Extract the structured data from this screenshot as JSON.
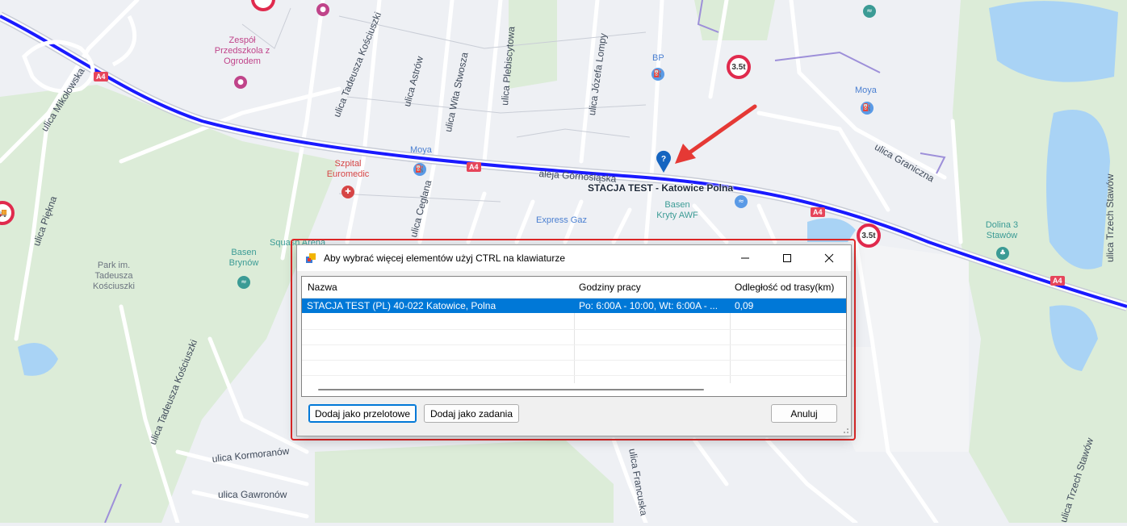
{
  "dialog": {
    "title": "Aby wybrać więcej elementów użyj CTRL na klawiaturze",
    "columns": [
      "Nazwa",
      "Godziny pracy",
      "Odległość od trasy(km)"
    ],
    "rows": [
      {
        "name": "STACJA TEST (PL) 40-022 Katowice, Polna",
        "hours": "Po: 6:00A - 10:00, Wt: 6:00A - ...",
        "distance": "0,09"
      }
    ],
    "buttons": {
      "add_waypoints": "Dodaj jako przelotowe",
      "add_tasks": "Dodaj jako zadania",
      "cancel": "Anuluj"
    },
    "window_icons": [
      "minimize-icon",
      "maximize-icon",
      "close-icon"
    ]
  },
  "map": {
    "station_label": "STACJA TEST - Katowice Polna",
    "streets": [
      "ulica Mikołowska",
      "ulica Tadeusza Kościuszki",
      "ulica Astrów",
      "ulica Wita Stwosza",
      "ulica Plebiscytowa",
      "ulica Józefa Lompy",
      "aleja Górnośląska",
      "ulica Graniczna",
      "ulica Trzech Stawów",
      "ulica Piękna",
      "ulica Ceglana",
      "ulica Tadeusza Kościuszki",
      "ulica Kormoranów",
      "ulica Gawronów",
      "ulica Francuska",
      "ulica Trzech Stawów"
    ],
    "pois": [
      "Zespół Przedszkola z Ogrodem",
      "BP",
      "Moya",
      "Moya",
      "Szpital Euromedic",
      "Express Gaz",
      "Basen Kryty AWF",
      "Dolina 3 Stawów",
      "Park im. Tadeusza Kościuszki",
      "Basen Brynów",
      "Squash Arena"
    ],
    "weight_limit": "3.5t",
    "road_shield": "A4",
    "colors": {
      "route": "#1a1aff",
      "highlight": "#e02828",
      "arrow": "#e53935",
      "selection": "#0078d7"
    },
    "marker_icon": "question-pin-icon"
  }
}
